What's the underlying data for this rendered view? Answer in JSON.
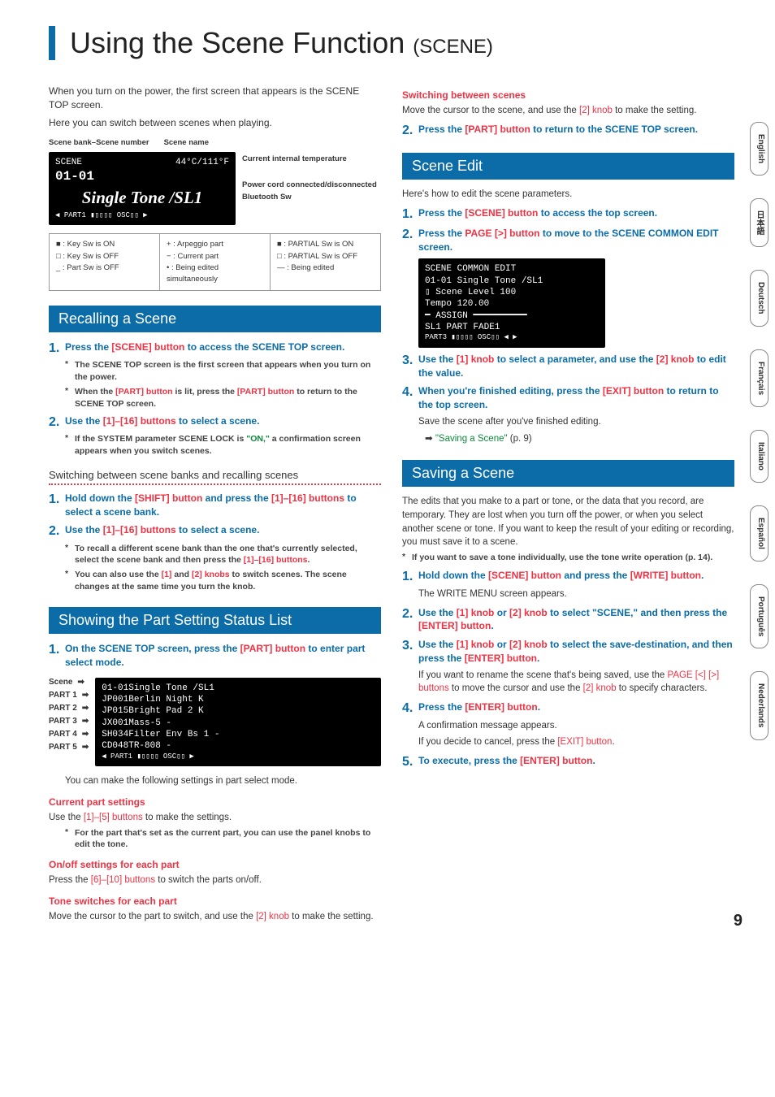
{
  "title": {
    "main": "Using the Scene Function ",
    "sub": "(SCENE)"
  },
  "intro": {
    "p1": "When you turn on the power, the first screen that appears is the SCENE TOP screen.",
    "p2": "Here you can switch between scenes when playing."
  },
  "diagram": {
    "lbl_bank": "Scene bank–Scene number",
    "lbl_name": "Scene name",
    "scr_scene": "SCENE",
    "scr_code": "01-01",
    "scr_temp": "44°C/111°F",
    "scr_title": "Single Tone /SL1",
    "scr_footnav": "◀  PART1 ▮▯▯▯▯  OSC▯▯        ▶",
    "call_temp": "Current internal temperature",
    "call_power": "Power cord connected/disconnected",
    "call_bt": "Bluetooth Sw",
    "legend": {
      "a1": "■ : Key Sw is ON",
      "a2": "□ : Key Sw is OFF",
      "a3": "_ : Part Sw is OFF",
      "b1": "+ : Arpeggio part",
      "b2": "− : Current part",
      "b3": "• : Being edited simultaneously",
      "c1": "■ : PARTIAL Sw is ON",
      "c2": "□ : PARTIAL Sw is OFF",
      "c3": "— : Being edited"
    }
  },
  "recall": {
    "heading": "Recalling a Scene",
    "s1_a": "Press the ",
    "s1_b": "[SCENE] button",
    "s1_c": " to access the SCENE TOP screen.",
    "s1n1": "The SCENE TOP screen is the first screen that appears when you turn on the power.",
    "s1n2_a": "When the ",
    "s1n2_b": "[PART] button",
    "s1n2_c": " is lit, press the ",
    "s1n2_d": "[PART] button",
    "s1n2_e": " to return to the SCENE TOP screen.",
    "s2_a": "Use the ",
    "s2_b": "[1]–[16] buttons",
    "s2_c": " to select a scene.",
    "s2n1_a": "If the SYSTEM parameter SCENE LOCK is ",
    "s2n1_b": "\"ON,\"",
    "s2n1_c": " a confirmation screen appears when you switch scenes.",
    "sub": "Switching between scene banks and recalling scenes",
    "b1_a": "Hold down the ",
    "b1_b": "[SHIFT] button",
    "b1_c": " and press the ",
    "b1_d": "[1]–[16] buttons",
    "b1_e": " to select a scene bank.",
    "b2_a": "Use the ",
    "b2_b": "[1]–[16] buttons",
    "b2_c": " to select a scene.",
    "b2n1_a": "To recall a different scene bank than the one that's currently selected, select the scene bank and then press the ",
    "b2n1_b": "[1]–[16] buttons",
    "b2n1_c": ".",
    "b2n2_a": "You can also use the ",
    "b2n2_b": "[1]",
    "b2n2_c": " and ",
    "b2n2_d": "[2] knobs",
    "b2n2_e": " to switch scenes. The scene changes at the same time you turn the knob."
  },
  "partstatus": {
    "heading": "Showing the Part Setting Status List",
    "s1_a": "On the SCENE TOP screen, press the ",
    "s1_b": "[PART] button",
    "s1_c": " to enter part select mode.",
    "list_lbl": [
      "Scene",
      "PART 1",
      "PART 2",
      "PART 3",
      "PART 4",
      "PART 5"
    ],
    "scr_lines": [
      "01-01Single Tone /SL1",
      "JP001Berlin Night      K",
      "JP015Bright Pad 2     K",
      "JX001Mass-5           -",
      "SH034Filter Env Bs 1  -",
      "CD048TR-808           -",
      "◀  PART1 ▮▯▯▯▯  OSC▯▯   ▶"
    ],
    "after": "You can make the following settings in part select mode.",
    "h1": "Current part settings",
    "h1p_a": "Use the ",
    "h1p_b": "[1]–[5] buttons",
    "h1p_c": " to make the settings.",
    "h1n": "For the part that's set as the current part, you can use the panel knobs to edit the tone.",
    "h2": "On/off settings for each part",
    "h2p_a": "Press the ",
    "h2p_b": "[6]–[10] buttons",
    "h2p_c": " to switch the parts on/off.",
    "h3": "Tone switches for each part",
    "h3p_a": "Move the cursor to the part to switch, and use the ",
    "h3p_b": "[2] knob",
    "h3p_c": " to make the setting."
  },
  "rightcol": {
    "sw_head": "Switching between scenes",
    "sw_p_a": "Move the cursor to the scene, and use the ",
    "sw_p_b": "[2] knob",
    "sw_p_c": " to make the setting.",
    "sw_s2_a": "Press the ",
    "sw_s2_b": "[PART] button",
    "sw_s2_c": " to return to the SCENE TOP screen.",
    "edit_heading": "Scene Edit",
    "edit_intro": "Here's how to edit the scene parameters.",
    "e1_a": "Press the ",
    "e1_b": "[SCENE] button",
    "e1_c": " to access the top screen.",
    "e2_a": "Press the ",
    "e2_b": "PAGE [>] button",
    "e2_c": " to move to the SCENE COMMON EDIT screen.",
    "escr": [
      "SCENE COMMON EDIT",
      "01-01 Single Tone /SL1",
      "▯ Scene Level      100",
      "  Tempo        120.00",
      "  ━ ASSIGN ━━━━━━━━━━",
      "  SL1     PART FADE1",
      " PART3 ▮▯▯▯▯ OSC▯▯   ◀ ▶"
    ],
    "e3_a": "Use the ",
    "e3_b": "[1] knob",
    "e3_c": " to select a parameter, and use the ",
    "e3_d": "[2] knob",
    "e3_e": " to edit the value.",
    "e4_a": "When you're finished editing, press the ",
    "e4_b": "[EXIT] button",
    "e4_c": " to return to the top screen.",
    "e4_p": "Save the scene after you've finished editing.",
    "e4_link_a": "\"Saving a Scene\"",
    "e4_link_b": " (p. 9)",
    "save_heading": "Saving a Scene",
    "save_intro": "The edits that you make to a part or tone, or the data that you record, are temporary. They are lost when you turn off the power, or when you select another scene or tone. If you want to keep the result of your editing or recording, you must save it to a scene.",
    "save_note": "If you want to save a tone individually, use the tone write operation (p. 14).",
    "sv1_a": "Hold down the ",
    "sv1_b": "[SCENE] button",
    "sv1_c": " and press the ",
    "sv1_d": "[WRITE] button",
    "sv1_e": ".",
    "sv1_p": "The WRITE MENU screen appears.",
    "sv2_a": "Use the ",
    "sv2_b": "[1] knob",
    "sv2_c": " or ",
    "sv2_d": "[2] knob",
    "sv2_e": " to select \"SCENE,\" and then press the ",
    "sv2_f": "[ENTER] button",
    "sv2_g": ".",
    "sv3_a": "Use the ",
    "sv3_b": "[1] knob",
    "sv3_c": " or ",
    "sv3_d": "[2] knob",
    "sv3_e": " to select the save-destination, and then press the ",
    "sv3_f": "[ENTER] button",
    "sv3_g": ".",
    "sv3_p_a": "If you want to rename the scene that's being saved, use the ",
    "sv3_p_b": "PAGE [<] [>] buttons",
    "sv3_p_c": " to move the cursor and use the ",
    "sv3_p_d": "[2] knob",
    "sv3_p_e": " to specify characters.",
    "sv4_a": "Press the ",
    "sv4_b": "[ENTER] button",
    "sv4_c": ".",
    "sv4_p1": "A confirmation message appears.",
    "sv4_p2_a": "If you decide to cancel, press the ",
    "sv4_p2_b": "[EXIT] button",
    "sv4_p2_c": ".",
    "sv5_a": "To execute, press the ",
    "sv5_b": "[ENTER] button",
    "sv5_c": "."
  },
  "tabs": [
    "English",
    "日本語",
    "Deutsch",
    "Français",
    "Italiano",
    "Español",
    "Português",
    "Nederlands"
  ],
  "page_number": "9"
}
